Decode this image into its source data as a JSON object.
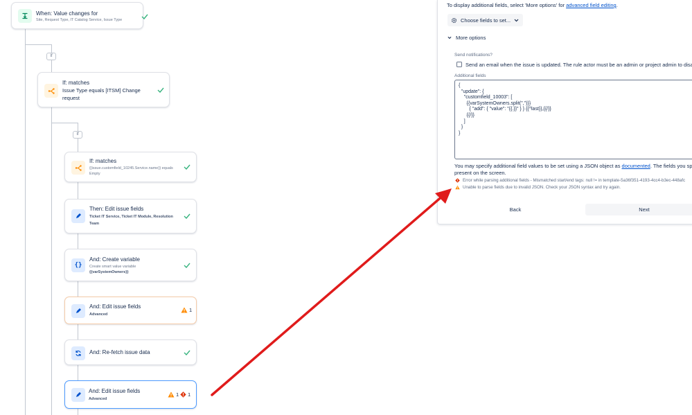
{
  "trigger": {
    "title": "When: Value changes for",
    "subtitle": "Site, Request Type, IT Catalog Service, Issue Type"
  },
  "if_label_1": "If",
  "if_label_2": "If",
  "condition1": {
    "title": "If: matches",
    "line1": "Issue Type equals [ITSM] Change",
    "line2": "request"
  },
  "condition2": {
    "title": "If: matches",
    "line1": "{{issue.customfield_10245.Service.name}} equals",
    "line2": "Empty"
  },
  "action_edit1": {
    "title": "Then: Edit issue fields",
    "line1": "Ticket IT Service, Ticket IT Module, Resolution",
    "line2": "Team"
  },
  "action_var": {
    "title": "And: Create variable",
    "line1": "Create smart value variable",
    "line2": "{{varSystemOwners}}"
  },
  "action_edit2": {
    "title": "And: Edit issue fields",
    "sub": "Advanced",
    "warn_count": "1"
  },
  "action_refetch": {
    "title": "And: Re-fetch issue data"
  },
  "action_edit3": {
    "title": "And: Edit issue fields",
    "sub": "Advanced",
    "warn_count": "1",
    "error_count": "1"
  },
  "panel": {
    "intro_prefix": "To display additional fields, select 'More options' for ",
    "intro_link": "advanced field editing",
    "intro_suffix": ".",
    "choose_button": "Choose fields to set...",
    "more_options": "More options",
    "send_notifications_label": "Send notifications?",
    "send_email_text": "Send an email when the issue is updated. The rule actor must be an admin or project admin to disab",
    "additional_fields_label": "Additional fields",
    "json_text": "{\n  \"update\": {\n    \"customfield_10003\": [\n      {{varSystemOwners.split(\",\")}}\n        { \"add\": { \"value\": \"{{.}}\" } } {{^last}},{{/}}\n      {{/}}\n    ]\n  }\n}",
    "help_prefix": "You may specify additional field values to be set using a JSON object as ",
    "help_link": "documented",
    "help_suffix": ". The fields you spec",
    "help_line2": "present on the screen.",
    "error1": "Error while parsing additional fields - Mismatched start/end tags: null != in template-5a36f351-4193-4cc4-b3ec-448afc",
    "error2": "Unable to parse fields due to invalid JSON. Check your JSON syntax and try again.",
    "back_button": "Back",
    "next_button": "Next"
  },
  "colors": {
    "accent_blue": "#0052cc",
    "success_green": "#36b37e",
    "warning_orange": "#ff8b00",
    "error_red": "#de350b",
    "annotation_arrow": "#e01b1b"
  }
}
